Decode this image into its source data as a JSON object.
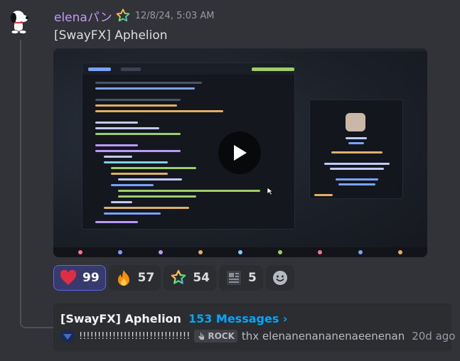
{
  "message": {
    "author": "elenaパン",
    "timestamp": "12/8/24, 5:03 AM",
    "text": "[SwayFX] Aphelion",
    "avatar_icon": "snoopy-avatar",
    "role_icon": "rainbow-star-icon",
    "username_color": "#c29af5"
  },
  "video": {
    "play_icon": "play-icon"
  },
  "reactions": [
    {
      "emoji": "heart",
      "count": "99",
      "me": true
    },
    {
      "emoji": "fire",
      "count": "57",
      "me": false
    },
    {
      "emoji": "rainbow-star",
      "count": "54",
      "me": false
    },
    {
      "emoji": "newspaper",
      "count": "5",
      "me": false
    }
  ],
  "add_reaction_icon": "smiley-add-icon",
  "thread": {
    "title": "[SwayFX] Aphelion",
    "message_count": "153 Messages ›",
    "last_user": "!!!!!!!!!!!!!!!!!!!!!!!!!!!!!!",
    "tag": "ROCK",
    "last_message": "thx elenanenananenaeenenan",
    "time": "20d ago"
  },
  "colors": {
    "accent": "#5865f2",
    "link": "#00a8fc",
    "background": "#313338"
  }
}
